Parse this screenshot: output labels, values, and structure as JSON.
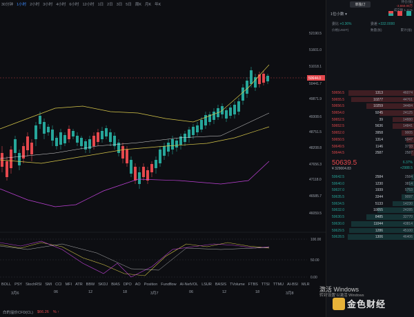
{
  "toolbar": {
    "timeframes": [
      "30分钟",
      "1小时",
      "2小时",
      "3小时",
      "4小时",
      "6小时",
      "12小时",
      "1日",
      "2日",
      "3日",
      "5日",
      "周K",
      "月K",
      "年K"
    ],
    "active_index": 1
  },
  "price_axis": [
    "52190.5",
    "51601.0",
    "51018.1",
    "50644.0",
    "50441.7",
    "49871.9",
    "49308.6",
    "48751.5",
    "48208.8",
    "47656.3",
    "47118.0",
    "46585.7",
    "46059.5"
  ],
  "current_price_label": "50644.0",
  "osc_axis": [
    "100.00",
    "50.00",
    "0.00"
  ],
  "indicators": [
    "BOLL",
    "PSY",
    "StochRSI",
    "SMI",
    "CCI",
    "MFI",
    "ATR",
    "BBW",
    "SKDJ",
    "BIAS",
    "DPO",
    "AO",
    "Position",
    "Fundflow",
    "AI-NetVOL",
    "LSUR",
    "BASIS",
    "TVolume",
    "FTBS",
    "TTSI",
    "TTMU",
    "AI-BSI",
    "MLR"
  ],
  "time_axis": [
    "3月6",
    "06",
    "12",
    "18",
    "3月7",
    "06",
    "12",
    "18",
    "3月8"
  ],
  "footer": {
    "label": "白的溢价CFD(CL)",
    "value": "$66.26",
    "pct": "% ↑"
  },
  "right": {
    "tab": "单独订",
    "stat_lines": [
      "持仓(张)",
      "-3,550.00万",
      "成交额 1.11%"
    ],
    "precision": "1位小数 ▾",
    "ratio_label": "委比",
    "ratio_value": "+0.36%",
    "diff_label": "委差",
    "diff_value": "+332.0000",
    "headers": [
      "价格(USDT)",
      "数量(张)",
      "累计(张)"
    ],
    "asks": [
      {
        "p": "50656.5",
        "q": "1313",
        "c": "46074",
        "w": 0.75
      },
      {
        "p": "50655.5",
        "q": "10277",
        "c": "44761",
        "w": 0.72
      },
      {
        "p": "50656.5",
        "q": "10259",
        "c": "34484",
        "w": 0.55
      },
      {
        "p": "50654.0",
        "q": "9245",
        "c": "24125",
        "w": 0.4
      },
      {
        "p": "50652.5",
        "q": "39",
        "c": "14880",
        "w": 0.25
      },
      {
        "p": "50652.5",
        "q": "5636",
        "c": "14841",
        "w": 0.25
      },
      {
        "p": "50652.0",
        "q": "3958",
        "c": "9005",
        "w": 0.15
      },
      {
        "p": "50650.5",
        "q": "1314",
        "c": "5047",
        "w": 0.09
      },
      {
        "p": "50649.5",
        "q": "1146",
        "c": "3733",
        "w": 0.06
      },
      {
        "p": "50644.5",
        "q": "2587",
        "c": "2587",
        "w": 0.04
      }
    ],
    "mid": {
      "price": "50639.5",
      "sub": "¥ 329004.83",
      "pct": "6.37%",
      "chg": "+2988.5"
    },
    "bids": [
      {
        "p": "50642.5",
        "q": "2584",
        "c": "2584",
        "w": 0.04
      },
      {
        "p": "50640.0",
        "q": "1230",
        "c": "3814",
        "w": 0.06
      },
      {
        "p": "50637.0",
        "q": "1939",
        "c": "5753",
        "w": 0.09
      },
      {
        "p": "50635.5",
        "q": "3344",
        "c": "9097",
        "w": 0.15
      },
      {
        "p": "50634.5",
        "q": "5133",
        "c": "14230",
        "w": 0.25
      },
      {
        "p": "50632.0",
        "q": "10055",
        "c": "24285",
        "w": 0.42
      },
      {
        "p": "50630.5",
        "q": "8485",
        "c": "32770",
        "w": 0.55
      },
      {
        "p": "50630.0",
        "q": "11044",
        "c": "43814",
        "w": 0.72
      },
      {
        "p": "50629.5",
        "q": "1286",
        "c": "45100",
        "w": 0.74
      },
      {
        "p": "50628.5",
        "q": "1306",
        "c": "46406",
        "w": 0.76
      }
    ]
  },
  "overlay": {
    "line1": "激活 Windows",
    "line2": "转到'设置'以激活 Windows"
  },
  "watermark": "金色财经",
  "colors": {
    "up": "#26a69a",
    "down": "#e5484d",
    "accent": "#3d8bff"
  }
}
